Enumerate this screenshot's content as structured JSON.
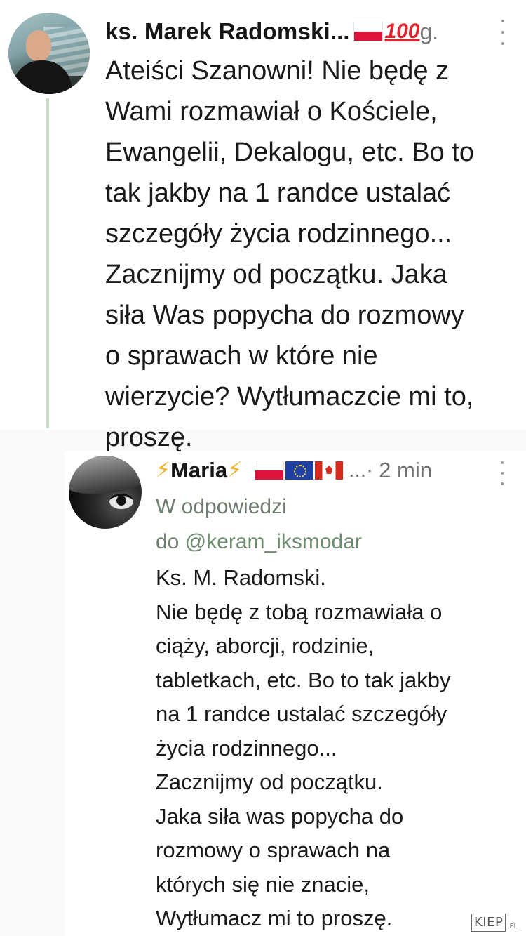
{
  "tweet1": {
    "author_name": "ks. Marek Radomski",
    "name_truncation": "...",
    "emoji_100": "100",
    "time": "g.",
    "body": "Ateiści Szanowni! Nie będę z\nWami rozmawiał o Kościele,\nEwangelii, Dekalogu, etc. Bo to\ntak jakby na 1 randce ustalać\nszczegóły życia rodzinnego...\nZacznijmy od początku. Jaka\nsiła Was popycha do rozmowy\no sprawach w które nie\nwierzycie? Wytłumaczcie mi to,\nproszę."
  },
  "tweet2": {
    "bolt_left": "⚡",
    "author_name": "Maria",
    "bolt_right": "⚡",
    "name_truncation": "...·",
    "time": "2 min",
    "reply_prefix_line1": "W odpowiedzi",
    "reply_prefix_line2": "do ",
    "reply_handle": "@keram_iksmodar",
    "body": "Ks. M. Radomski.\nNie będę z tobą rozmawiała o\nciąży, aborcji, rodzinie,\ntabletkach, etc. Bo to tak jakby\nna 1 randce ustalać szczegóły\nżycia rodzinnego...\nZacznijmy od początku.\nJaka siła was popycha do\nrozmowy o sprawach na\nktórych się nie znacie,\nWytłumacz mi to proszę."
  },
  "watermark": {
    "text": "KIEP",
    "suffix": ".PL"
  },
  "colors": {
    "thread_line": "#c7dcc9",
    "reply_text": "#6f7f6f",
    "bolt": "#f2b01e",
    "emoji_100": "#e0242f"
  }
}
